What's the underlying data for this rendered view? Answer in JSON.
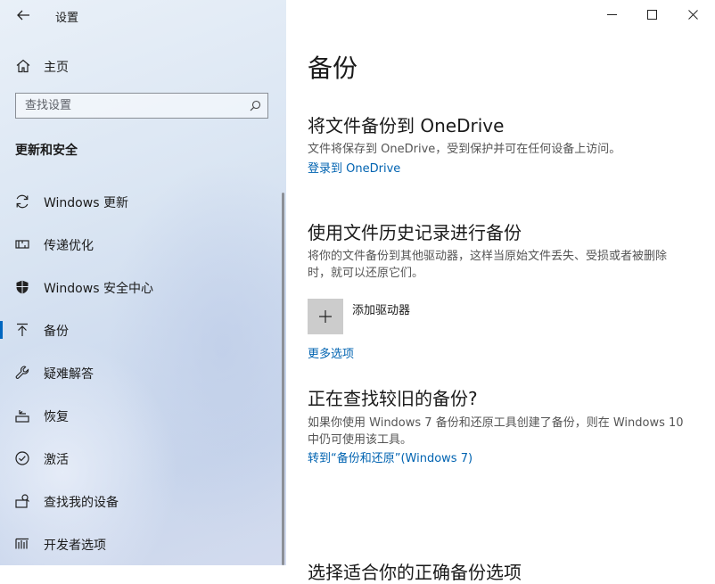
{
  "window": {
    "title": "设置",
    "controls": [
      "minimize",
      "maximize",
      "close"
    ]
  },
  "sidebar": {
    "home_label": "主页",
    "search_placeholder": "查找设置",
    "section_title": "更新和安全",
    "items": [
      {
        "label": "Windows 更新",
        "icon": "sync-icon"
      },
      {
        "label": "传递优化",
        "icon": "delivery-optimization-icon"
      },
      {
        "label": "Windows 安全中心",
        "icon": "shield-icon"
      },
      {
        "label": "备份",
        "icon": "backup-arrow-icon",
        "active": true
      },
      {
        "label": "疑难解答",
        "icon": "wrench-icon"
      },
      {
        "label": "恢复",
        "icon": "recovery-icon"
      },
      {
        "label": "激活",
        "icon": "activation-check-icon"
      },
      {
        "label": "查找我的设备",
        "icon": "find-device-icon"
      },
      {
        "label": "开发者选项",
        "icon": "developer-icon"
      }
    ]
  },
  "main": {
    "title": "备份",
    "onedrive": {
      "heading": "将文件备份到 OneDrive",
      "desc": "文件将保存到 OneDrive，受到保护并可在任何设备上访问。",
      "link": "登录到 OneDrive"
    },
    "file_history": {
      "heading": "使用文件历史记录进行备份",
      "desc": "将你的文件备份到其他驱动器，这样当原始文件丢失、受损或者被删除时，就可以还原它们。",
      "add_drive_label": "添加驱动器",
      "more_options": "更多选项"
    },
    "older_backup": {
      "heading": "正在查找较旧的备份?",
      "desc": "如果你使用 Windows 7 备份和还原工具创建了备份，则在 Windows 10 中仍可使用该工具。",
      "link": "转到“备份和还原”(Windows 7)"
    },
    "cut_off_heading": "选择适合你的正确备份选项"
  },
  "colors": {
    "accent": "#0063b1",
    "active_indicator": "#0067c0",
    "tile": "#cccccc"
  }
}
